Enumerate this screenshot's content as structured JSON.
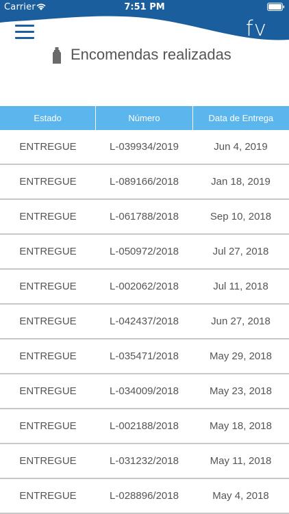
{
  "status_bar": {
    "carrier": "Carrier",
    "time": "7:51 PM"
  },
  "header": {
    "logo": "fv",
    "brand_color": "#1b5e9e",
    "menu_icon": "hamburger-menu-icon"
  },
  "page": {
    "title": "Encomendas realizadas",
    "title_icon": "bottle-icon"
  },
  "table": {
    "header_color": "#5cb6ee",
    "columns": [
      "Estado",
      "Número",
      "Data de Entrega"
    ],
    "rows": [
      [
        "ENTREGUE",
        "L-039934/2019",
        "Jun 4, 2019"
      ],
      [
        "ENTREGUE",
        "L-089166/2018",
        "Jan 18, 2019"
      ],
      [
        "ENTREGUE",
        "L-061788/2018",
        "Sep 10, 2018"
      ],
      [
        "ENTREGUE",
        "L-050972/2018",
        "Jul 27, 2018"
      ],
      [
        "ENTREGUE",
        "L-002062/2018",
        "Jul 11, 2018"
      ],
      [
        "ENTREGUE",
        "L-042437/2018",
        "Jun 27, 2018"
      ],
      [
        "ENTREGUE",
        "L-035471/2018",
        "May 29, 2018"
      ],
      [
        "ENTREGUE",
        "L-034009/2018",
        "May 23, 2018"
      ],
      [
        "ENTREGUE",
        "L-002188/2018",
        "May 18, 2018"
      ],
      [
        "ENTREGUE",
        "L-031232/2018",
        "May 11, 2018"
      ],
      [
        "ENTREGUE",
        "L-028896/2018",
        "May 4, 2018"
      ]
    ]
  }
}
